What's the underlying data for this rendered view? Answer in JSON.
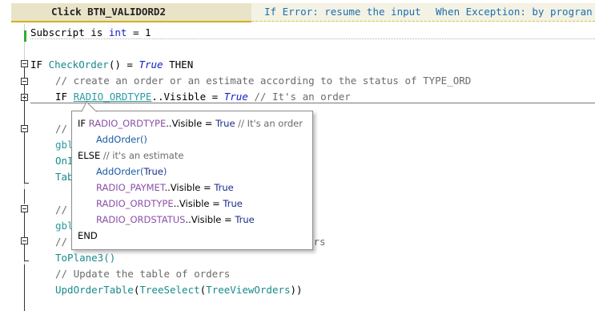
{
  "header": {
    "event_label": "Click BTN_VALIDORD2",
    "error_handling": "If Error: resume the input",
    "exception_handling": "When Exception: by progran"
  },
  "code": {
    "line1": {
      "prefix": "Subscript is ",
      "type": "int",
      "suffix": " = 1"
    },
    "line2": {
      "kw_if": "IF ",
      "func": "CheckOrder",
      "args": "() = ",
      "true": "True",
      "then": " THEN"
    },
    "line3": "// create an order or an estimate according to the status of TYPE_ORD",
    "line4": {
      "kw_if": "IF ",
      "ctrl": "RADIO_ORDTYPE",
      "prop": "..Visible = ",
      "true": "True",
      "comment": " // It's an order"
    },
    "line5": "// ",
    "line6": "gbl",
    "line7": "OnI",
    "line8": "Tab",
    "line9": "// ",
    "line10": "gbl",
    "line11": "//",
    "line11_tail": "ers",
    "line12": "ToPlane3()",
    "line13": "// Update the table of orders",
    "line14": {
      "func": "UpdOrderTable",
      "inner": "TreeSelect",
      "arg": "TreeViewOrders",
      "tail": "))"
    }
  },
  "tooltip": {
    "l1_if": "IF ",
    "l1_ctrl": "RADIO_ORDTYPE",
    "l1_prop": "..Visible = ",
    "l1_true": "True",
    "l1_comment": " // It's an order",
    "l2": "AddOrder()",
    "l3_else": "ELSE",
    "l3_comment": " // it's an estimate",
    "l4_func": "AddOrder(",
    "l4_true": "True",
    "l4_close": ")",
    "l5_ctrl": "RADIO_PAYMET",
    "l5_prop": "..Visible = ",
    "l5_true": "True",
    "l6_ctrl": "RADIO_ORDTYPE",
    "l6_prop": "..Visible = ",
    "l6_true": "True",
    "l7_ctrl": "RADIO_ORDSTATUS",
    "l7_prop": "..Visible = ",
    "l7_true": "True",
    "l8": "END"
  }
}
